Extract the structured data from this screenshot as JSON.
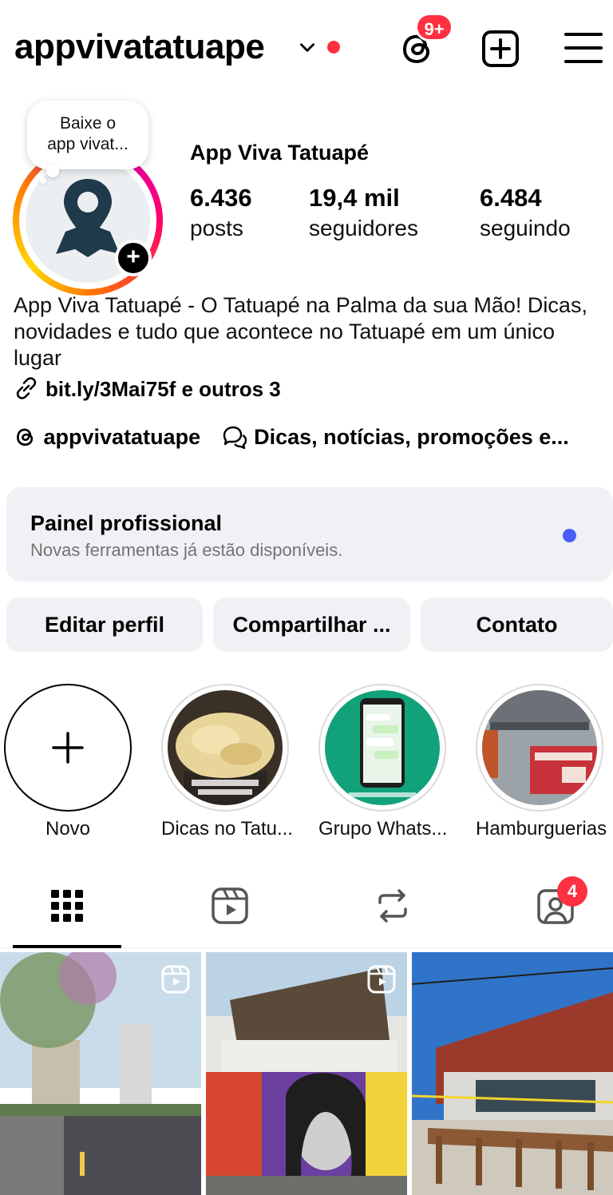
{
  "header": {
    "username": "appvivatatuape",
    "threads_badge": "9+"
  },
  "profile": {
    "note": "Baixe o\napp vivat...",
    "display_name": "App Viva Tatuapé",
    "stats": [
      {
        "num": "6.436",
        "label": "posts"
      },
      {
        "num": "19,4 mil",
        "label": "seguidores"
      },
      {
        "num": "6.484",
        "label": "seguindo"
      }
    ],
    "bio": "App Viva Tatuapé - O Tatuapé na Palma da sua Mão! Dicas, novidades e tudo que acontece no Tatuapé em um único lugar",
    "link": "bit.ly/3Mai75f e outros 3",
    "threads_handle": "appvivatatuape",
    "channel": "Dicas, notícias, promoções e..."
  },
  "panel": {
    "title": "Painel profissional",
    "subtitle": "Novas ferramentas já estão disponíveis."
  },
  "buttons": {
    "edit": "Editar perfil",
    "share": "Compartilhar ...",
    "contact": "Contato"
  },
  "highlights": [
    {
      "label": "Novo"
    },
    {
      "label": "Dicas no Tatu..."
    },
    {
      "label": "Grupo Whats..."
    },
    {
      "label": "Hamburguerias"
    }
  ],
  "tabs": {
    "tagged_badge": "4"
  },
  "colors": {
    "accent_red": "#ff3040",
    "panel_dot": "#4a5df9",
    "button_bg": "#eff1f4"
  }
}
